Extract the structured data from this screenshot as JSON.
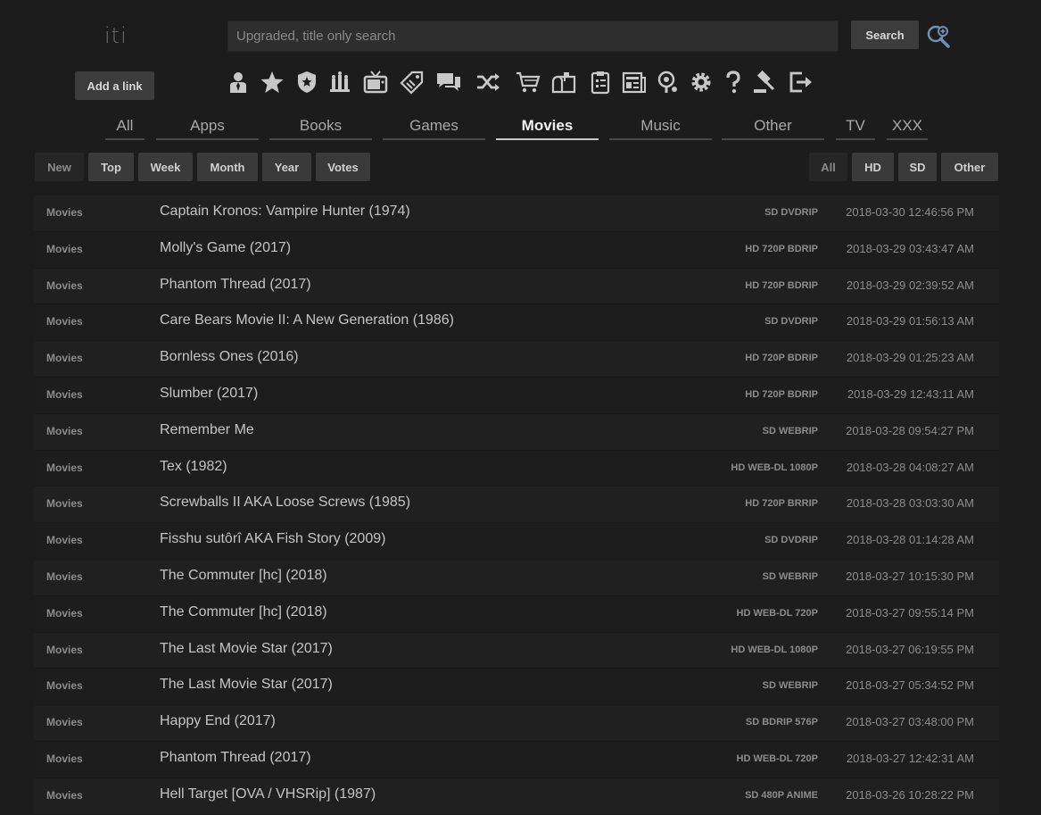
{
  "logo": "iti",
  "search": {
    "placeholder": "Upgraded, title only search",
    "button_label": "Search"
  },
  "add_link_label": "Add a link",
  "toolbar_icons": [
    "user-icon",
    "star-icon",
    "shield-icon",
    "awards-icon",
    "tv-icon",
    "tag-icon",
    "chat-icon",
    "shuffle-icon",
    "cart-icon",
    "mailbox-icon",
    "clipboard-icon",
    "news-icon",
    "magnify-icon",
    "gear-icon",
    "help-icon",
    "gavel-icon",
    "logout-icon"
  ],
  "category_tabs": [
    {
      "label": "All"
    },
    {
      "label": "Apps"
    },
    {
      "label": "Books"
    },
    {
      "label": "Games"
    },
    {
      "label": "Movies",
      "active": true
    },
    {
      "label": "Music"
    },
    {
      "label": "Other"
    },
    {
      "label": "TV"
    },
    {
      "label": "XXX"
    }
  ],
  "sort_filters": [
    {
      "label": "New",
      "active": true
    },
    {
      "label": "Top"
    },
    {
      "label": "Week"
    },
    {
      "label": "Month"
    },
    {
      "label": "Year"
    },
    {
      "label": "Votes"
    }
  ],
  "quality_filters": [
    {
      "label": "All",
      "active": true
    },
    {
      "label": "HD"
    },
    {
      "label": "SD"
    },
    {
      "label": "Other"
    }
  ],
  "rows": [
    {
      "category": "Movies",
      "title": "Captain Kronos: Vampire Hunter (1974)",
      "quality": "SD DVDRIP",
      "date": "2018-03-30 12:46:56 PM"
    },
    {
      "category": "Movies",
      "title": "Molly's Game (2017)",
      "quality": "HD 720P BDRIP",
      "date": "2018-03-29 03:43:47 AM"
    },
    {
      "category": "Movies",
      "title": "Phantom Thread (2017)",
      "quality": "HD 720P BDRIP",
      "date": "2018-03-29 02:39:52 AM"
    },
    {
      "category": "Movies",
      "title": "Care Bears Movie II: A New Generation (1986)",
      "quality": "SD DVDRIP",
      "date": "2018-03-29 01:56:13 AM"
    },
    {
      "category": "Movies",
      "title": "Bornless Ones (2016)",
      "quality": "HD 720P BDRIP",
      "date": "2018-03-29 01:25:23 AM"
    },
    {
      "category": "Movies",
      "title": "Slumber (2017)",
      "quality": "HD 720P BDRIP",
      "date": "2018-03-29 12:43:11 AM"
    },
    {
      "category": "Movies",
      "title": "Remember Me",
      "quality": "SD WEBRIP",
      "date": "2018-03-28 09:54:27 PM"
    },
    {
      "category": "Movies",
      "title": "Tex (1982)",
      "quality": "HD WEB-DL 1080P",
      "date": "2018-03-28 04:08:27 AM"
    },
    {
      "category": "Movies",
      "title": "Screwballs II AKA Loose Screws (1985)",
      "quality": "HD 720P BRRIP",
      "date": "2018-03-28 03:03:30 AM"
    },
    {
      "category": "Movies",
      "title": "Fisshu sutôrî AKA Fish Story (2009)",
      "quality": "SD DVDRIP",
      "date": "2018-03-28 01:14:28 AM"
    },
    {
      "category": "Movies",
      "title": "The Commuter [hc] (2018)",
      "quality": "SD WEBRIP",
      "date": "2018-03-27 10:15:30 PM"
    },
    {
      "category": "Movies",
      "title": "The Commuter [hc] (2018)",
      "quality": "HD WEB-DL 720P",
      "date": "2018-03-27 09:55:14 PM"
    },
    {
      "category": "Movies",
      "title": "The Last Movie Star (2017)",
      "quality": "HD WEB-DL 1080P",
      "date": "2018-03-27 06:19:55 PM"
    },
    {
      "category": "Movies",
      "title": "The Last Movie Star (2017)",
      "quality": "SD WEBRIP",
      "date": "2018-03-27 05:34:52 PM"
    },
    {
      "category": "Movies",
      "title": "Happy End (2017)",
      "quality": "SD BDRIP 576P",
      "date": "2018-03-27 03:48:00 PM"
    },
    {
      "category": "Movies",
      "title": "Phantom Thread (2017)",
      "quality": "HD WEB-DL 720P",
      "date": "2018-03-27 12:42:31 AM"
    },
    {
      "category": "Movies",
      "title": "Hell Target [OVA / VHSRip] (1987)",
      "quality": "SD 480P ANIME",
      "date": "2018-03-26 10:28:22 PM"
    }
  ]
}
